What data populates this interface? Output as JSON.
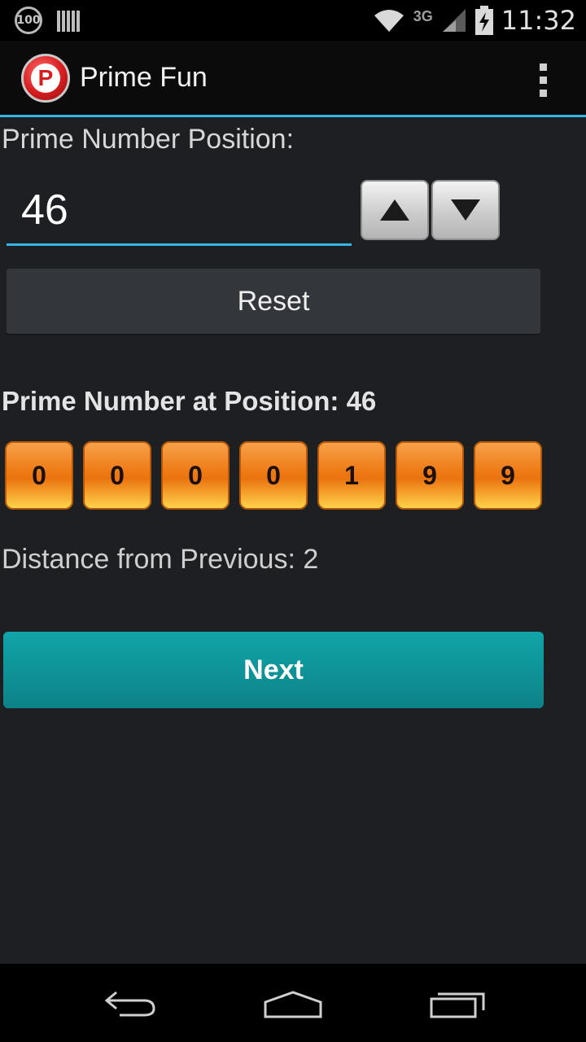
{
  "status_bar": {
    "battery_badge": "100",
    "network": "3G",
    "time": "11:32"
  },
  "app_bar": {
    "logo_letter": "P",
    "title": "Prime Fun"
  },
  "position_section": {
    "label": "Prime Number Position:",
    "value": "46",
    "reset_label": "Reset"
  },
  "result_section": {
    "label": "Prime Number at Position: 46",
    "digits": [
      "0",
      "0",
      "0",
      "0",
      "1",
      "9",
      "9"
    ],
    "distance_label": "Distance from Previous: 2"
  },
  "next_label": "Next",
  "colors": {
    "accent": "#33b5e5",
    "next_button": "#0f9398",
    "digit_orange": "#ee7a14"
  }
}
